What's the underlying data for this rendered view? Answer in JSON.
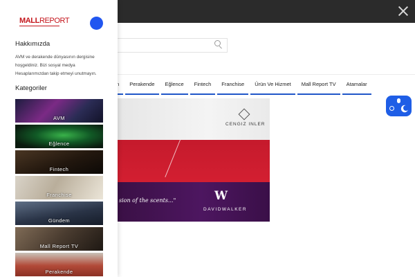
{
  "overlay": {
    "close_icon": "close-icon"
  },
  "search": {
    "placeholder": "",
    "icon": "search-icon"
  },
  "nav": {
    "items": [
      "m",
      "Perakende",
      "Eğlence",
      "Fintech",
      "Franchise",
      "Ürün Ve Hizmet",
      "Mall Report TV",
      "Atamalar"
    ],
    "accent_color": "#1f56c8"
  },
  "banners": {
    "cengiz": {
      "brand": "CENGIZ INLER"
    },
    "davidwalker": {
      "slogan": "sion of the scents...\"",
      "monogram": "W",
      "brand": "DAVIDWALKER"
    }
  },
  "theme_toggle": {
    "icons": [
      "sun-icon",
      "moon-icon"
    ],
    "color": "#1f5ee6"
  },
  "sidebar": {
    "logo": {
      "mall": "MALL",
      "report": "REPORT",
      "color": "#c4161c"
    },
    "about": {
      "heading": "Hakkımızda",
      "text": "AVM ve derakende dünyasının dergisine hoşgeldiniz. Bizi sosyal medya Hesaplarımızdan takip etmeyi unutmayın."
    },
    "categories": {
      "heading": "Kategoriler",
      "items": [
        {
          "label": "AVM"
        },
        {
          "label": "Eğlence"
        },
        {
          "label": "Fintech"
        },
        {
          "label": "Franchise"
        },
        {
          "label": "Gündem"
        },
        {
          "label": "Mall Report TV"
        },
        {
          "label": "Perakende"
        }
      ]
    }
  }
}
